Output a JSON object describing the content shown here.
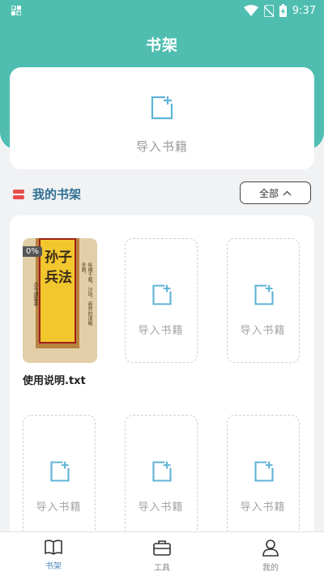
{
  "status_bar": {
    "time": "9:37"
  },
  "header": {
    "title": "书架"
  },
  "import_card": {
    "label": "导入书籍"
  },
  "shelf": {
    "title": "我的书架",
    "filter_label": "全部",
    "book": {
      "progress": "0%",
      "cover_title": "孙子兵法",
      "cover_subtitle": "古今通鉴本",
      "cover_author": "孙武",
      "cover_side_text": "纵横千载，沙场，商界的谋略圣典。",
      "name": "使用说明.txt"
    },
    "slots": [
      {
        "label": "导入书籍"
      },
      {
        "label": "导入书籍"
      },
      {
        "label": "导入书籍"
      },
      {
        "label": "导入书籍"
      },
      {
        "label": "导入书籍"
      }
    ]
  },
  "tabbar": {
    "items": [
      {
        "label": "书架",
        "active": true
      },
      {
        "label": "工具",
        "active": false
      },
      {
        "label": "我的",
        "active": false
      }
    ]
  },
  "colors": {
    "header": "#4fbeb0",
    "accent_blue": "#4d86b7",
    "icon_blue": "#5fb3d6",
    "muted": "#a5a5a5"
  }
}
